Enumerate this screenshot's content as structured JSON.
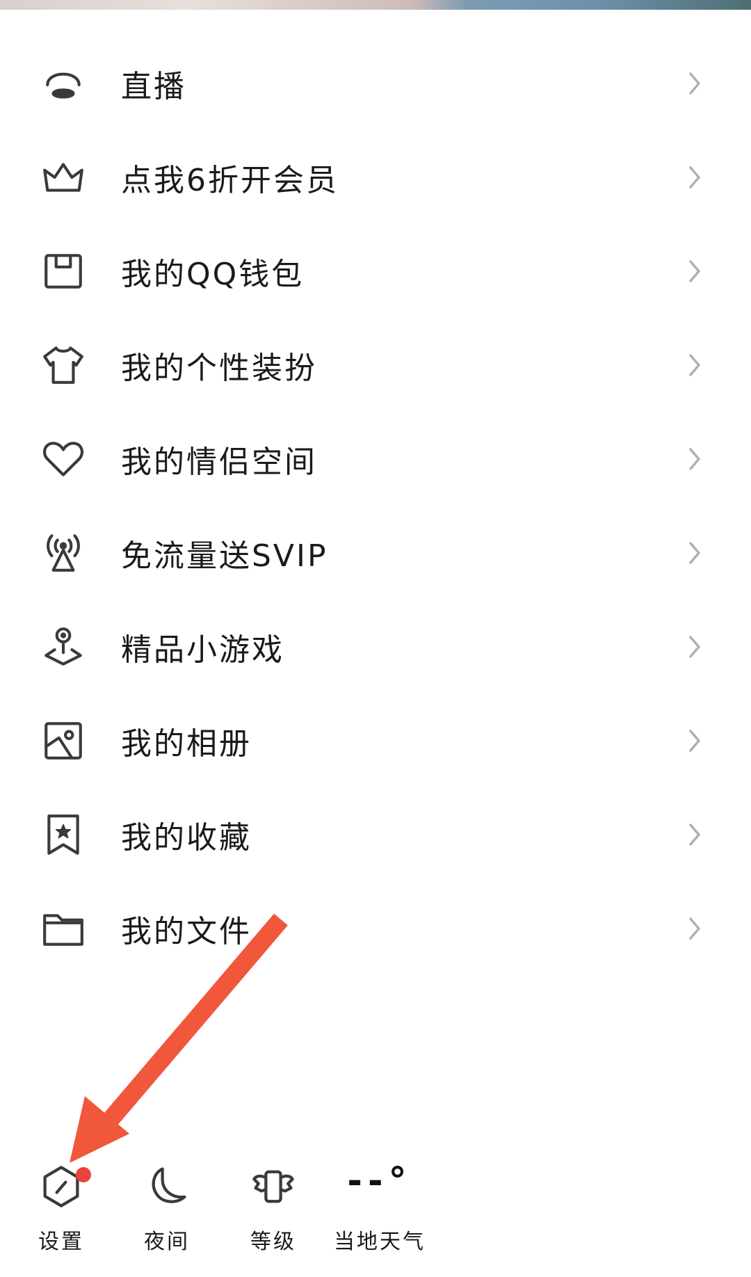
{
  "menu": {
    "items": [
      {
        "label": "直播",
        "icon": "live-dome-icon"
      },
      {
        "label": "点我6折开会员",
        "icon": "crown-icon"
      },
      {
        "label": "我的QQ钱包",
        "icon": "wallet-icon"
      },
      {
        "label": "我的个性装扮",
        "icon": "tshirt-icon"
      },
      {
        "label": "我的情侣空间",
        "icon": "heart-icon"
      },
      {
        "label": "免流量送SVIP",
        "icon": "signal-tower-icon"
      },
      {
        "label": "精品小游戏",
        "icon": "game-pin-icon"
      },
      {
        "label": "我的相册",
        "icon": "photo-album-icon"
      },
      {
        "label": "我的收藏",
        "icon": "bookmark-star-icon"
      },
      {
        "label": "我的文件",
        "icon": "folder-icon"
      }
    ]
  },
  "bottom_bar": {
    "settings": {
      "label": "设置",
      "icon": "settings-hexagon-icon"
    },
    "night": {
      "label": "夜间",
      "icon": "moon-icon"
    },
    "level": {
      "label": "等级",
      "icon": "level-wings-icon"
    },
    "weather": {
      "label": "当地天气",
      "value": "--°"
    }
  },
  "colors": {
    "icon_stroke": "#3a3a3a",
    "chevron": "#b0b0b0",
    "badge_red": "#e8453c",
    "annotation_arrow": "#f0573b"
  }
}
